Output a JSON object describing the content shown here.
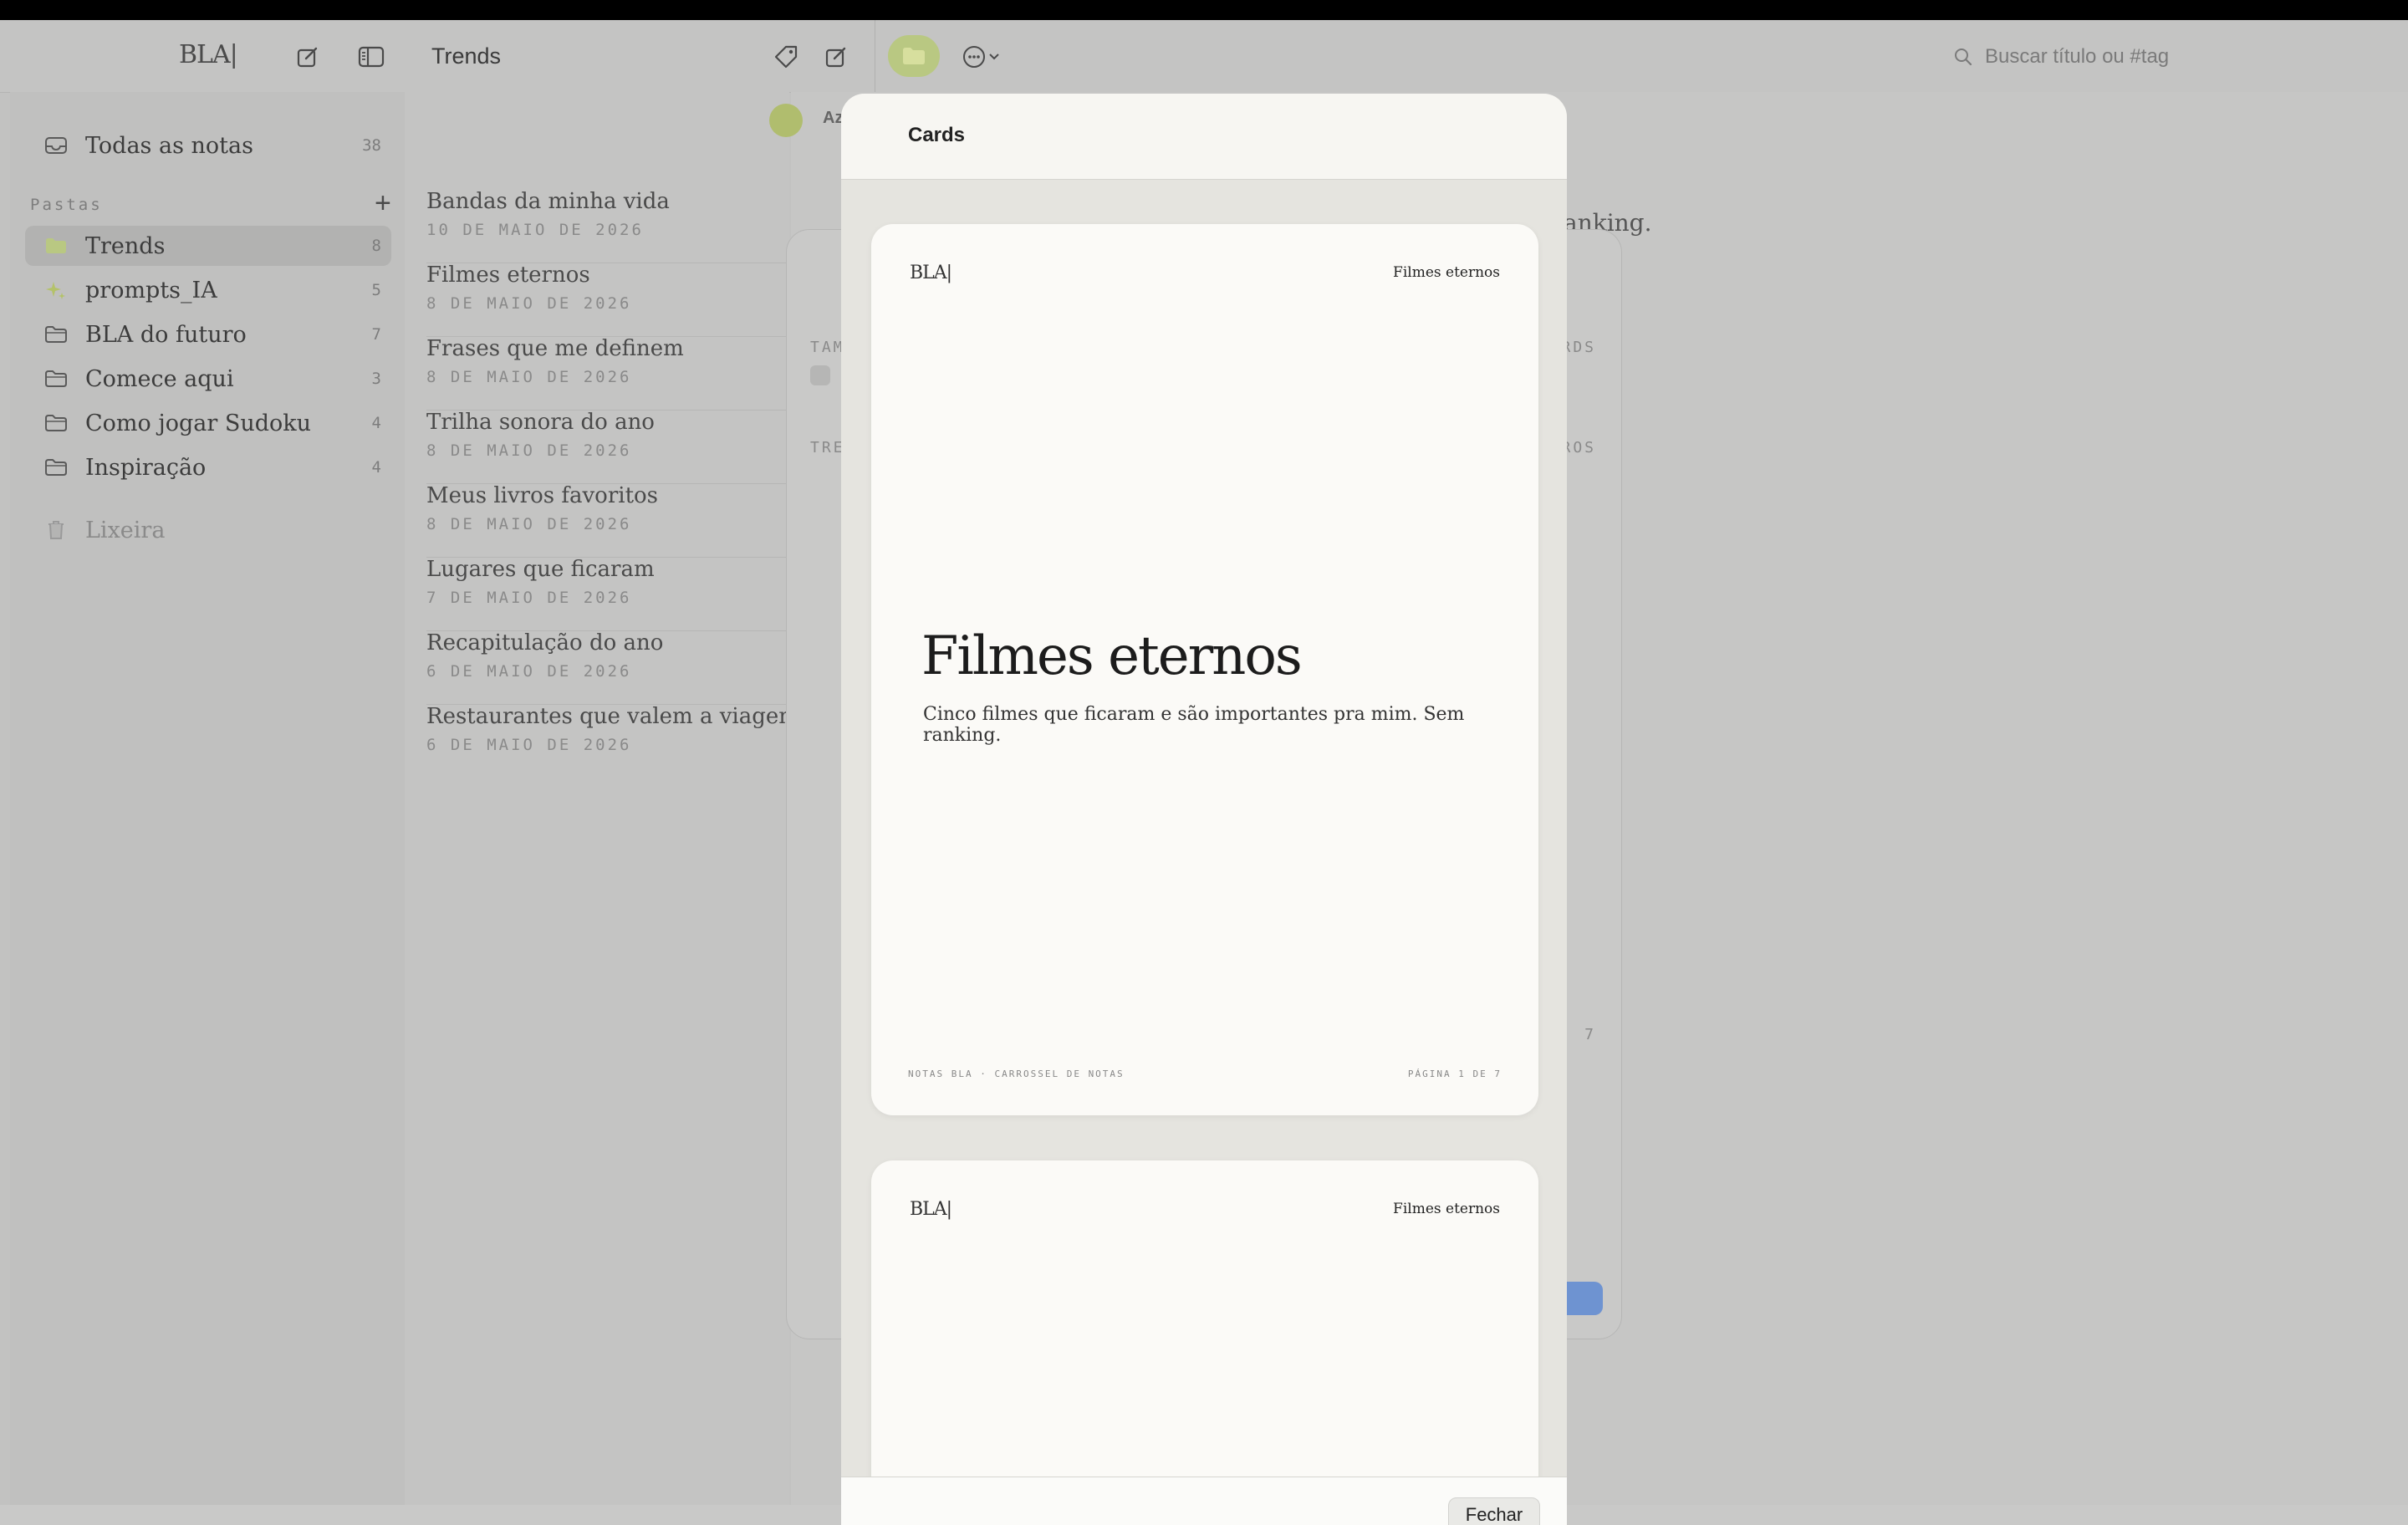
{
  "toolbar": {
    "logo": "BLA|",
    "title": "Trends",
    "search_placeholder": "Buscar título ou #tag",
    "icons": [
      "compose-icon",
      "sidebar-toggle-icon",
      "tag-icon",
      "compose-icon",
      "folder-icon",
      "more-options-icon"
    ]
  },
  "sidebar": {
    "all_notes": {
      "label": "Todas as notas",
      "count": "38"
    },
    "section_label": "Pastas",
    "folders": [
      {
        "label": "Trends",
        "count": "8",
        "icon": "folder-filled-icon"
      },
      {
        "label": "prompts_IA",
        "count": "5",
        "icon": "sparkle-icon"
      },
      {
        "label": "BLA do futuro",
        "count": "7",
        "icon": "folder-icon"
      },
      {
        "label": "Comece aqui",
        "count": "3",
        "icon": "folder-icon"
      },
      {
        "label": "Como jogar Sudoku",
        "count": "4",
        "icon": "folder-icon"
      },
      {
        "label": "Inspiração",
        "count": "4",
        "icon": "folder-icon"
      }
    ],
    "trash": {
      "label": "Lixeira",
      "icon": "trash-icon"
    }
  },
  "notes": [
    {
      "title": "Bandas da minha vida",
      "date": "10 DE MAIO DE 2026"
    },
    {
      "title": "Filmes eternos",
      "date": "8 DE MAIO DE 2026"
    },
    {
      "title": "Frases que me definem",
      "date": "8 DE MAIO DE 2026"
    },
    {
      "title": "Trilha sonora do ano",
      "date": "8 DE MAIO DE 2026"
    },
    {
      "title": "Meus livros favoritos",
      "date": "8 DE MAIO DE 2026"
    },
    {
      "title": "Lugares que ficaram",
      "date": "7 DE MAIO DE 2026"
    },
    {
      "title": "Recapitulação do ano",
      "date": "6 DE MAIO DE 2026"
    },
    {
      "title": "Restaurantes que valem a viagem",
      "date": "6 DE MAIO DE 2026"
    }
  ],
  "editor": {
    "sort_label": "Az",
    "text_fragment": "anking."
  },
  "bg_dialog": {
    "label_a": "TAM",
    "label_b": "TRE",
    "label_c": "RDS",
    "label_d": "ROS",
    "label_e": "7"
  },
  "sheet": {
    "title": "Cards",
    "close_label": "Fechar",
    "cards": [
      {
        "logo": "BLA|",
        "note_name": "Filmes eternos",
        "heading": "Filmes eternos",
        "subtitle": "Cinco filmes que ficaram e são importantes pra mim. Sem ranking.",
        "footer_left": "NOTAS BLA · CARROSSEL DE NOTAS",
        "footer_right": "PÁGINA 1 DE 7"
      },
      {
        "logo": "BLA|",
        "note_name": "Filmes eternos"
      }
    ]
  },
  "colors": {
    "accent_folder": "#b9c882",
    "button_blue": "#6e93d1"
  }
}
